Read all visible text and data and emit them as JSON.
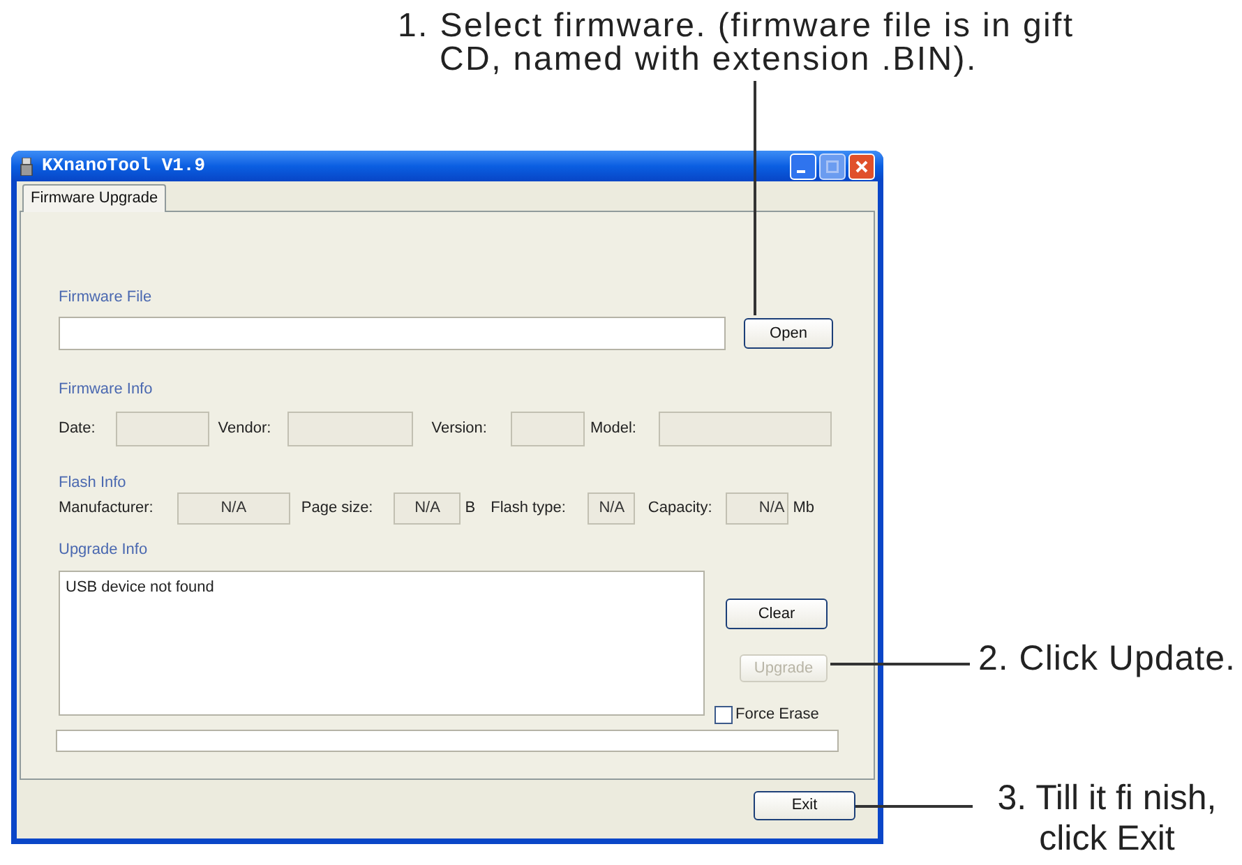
{
  "notes": [
    {
      "lines": [
        "1. Select firmware. (firmware file is in gift",
        "CD, named with extension .BIN)."
      ]
    },
    {
      "lines": [
        "2. Click Update."
      ]
    },
    {
      "lines": [
        "3. Till it fi nish,",
        "click Exit"
      ]
    }
  ],
  "window": {
    "title": "KXnanoTool V1.9"
  },
  "tabs": [
    {
      "label": "Firmware Upgrade",
      "selected": true
    }
  ],
  "firmware_file": {
    "label": "Firmware File",
    "button": "Open"
  },
  "firmware_info": {
    "label": "Firmware Info",
    "fields": [
      {
        "label": "Date:"
      },
      {
        "label": "Vendor:"
      },
      {
        "label": "Version:"
      },
      {
        "label": "Model:"
      }
    ]
  },
  "flash_info": {
    "label": "Flash Info",
    "fields": [
      {
        "label": "Manufacturer:",
        "value": "N/A"
      },
      {
        "label": "Page size:",
        "value": "N/A",
        "unit": "B"
      },
      {
        "label": "Flash type:",
        "value": "N/A"
      },
      {
        "label": "Capacity:",
        "value": "N/A",
        "unit": "Mb"
      }
    ]
  },
  "upgrade_info": {
    "label": "Upgrade Info",
    "log": "USB device not found",
    "buttons": [
      {
        "label": "Clear",
        "disabled": false
      },
      {
        "label": "Upgrade",
        "disabled": true
      }
    ],
    "force_erase": {
      "label": "Force Erase",
      "checked": false
    }
  },
  "exit_button": "Exit"
}
